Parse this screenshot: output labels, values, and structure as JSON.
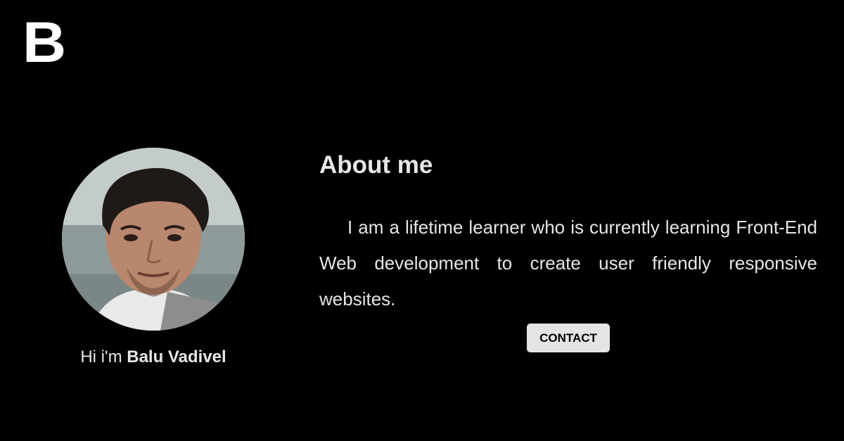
{
  "brand": {
    "logo_letter": "B"
  },
  "profile": {
    "greeting_prefix": "Hi i'm ",
    "name": "Balu Vadivel"
  },
  "about": {
    "title": "About me",
    "text": "I am a lifetime learner who is currently learning Front-End Web development to create user friendly responsive websites.",
    "contact_label": "CONTACT"
  },
  "colors": {
    "background": "#000000",
    "text": "#e6e6e6",
    "button_bg": "#e4e4e4",
    "button_text": "#000000"
  }
}
